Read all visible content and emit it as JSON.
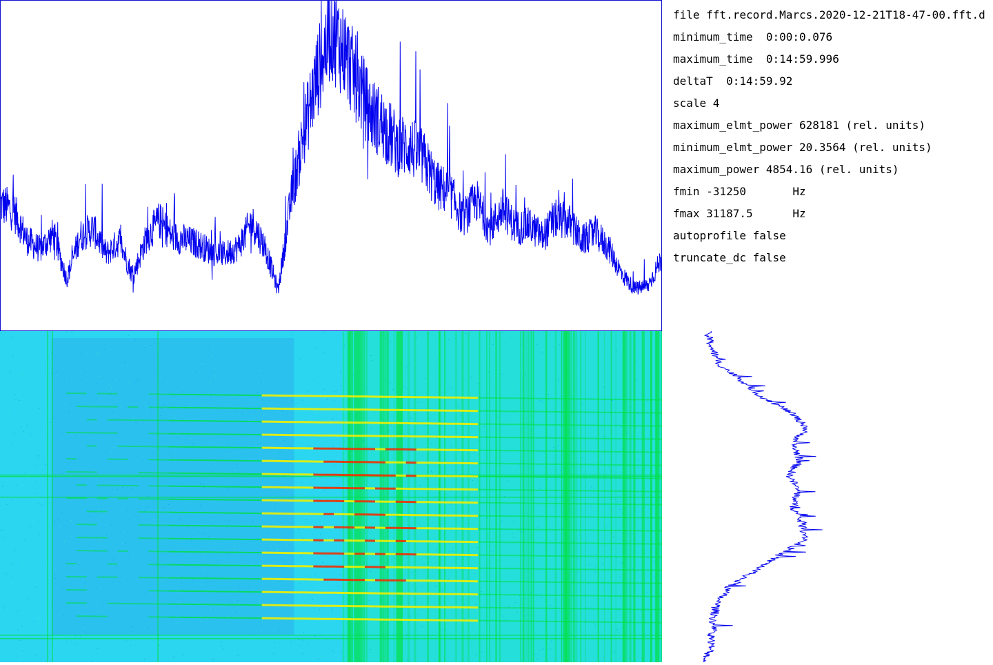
{
  "info": {
    "lines": [
      "file fft.record.Marcs.2020-12-21T18-47-00.fft.d",
      "minimum_time  0:00:0.076",
      "maximum_time  0:14:59.996",
      "deltaT  0:14:59.92",
      "scale 4",
      "maximum_elmt_power 628181 (rel. units)",
      "minimum_elmt_power 20.3564 (rel. units)",
      "maximum_power 4854.16 (rel. units)",
      "fmin -31250       Hz",
      "fmax 31187.5      Hz",
      "autoprofile false",
      "truncate_dc false"
    ]
  },
  "colors": {
    "trace": "#0000ee",
    "spectro_background": "#2bd6f0",
    "spectro_background_right": "#1fe8c8",
    "spectro_dark": "#2aa8ee",
    "spectro_green": "#00e040",
    "spectro_yellow": "#f0f000",
    "spectro_red": "#f03000"
  },
  "chart_data": [
    {
      "type": "line",
      "description_key": "total_power_vs_time",
      "title": "",
      "xlabel": "",
      "ylabel": "",
      "xlim": [
        0.076,
        899.996
      ],
      "ylim": [
        0,
        4854.16
      ],
      "x": [
        0,
        18,
        36,
        54,
        72,
        90,
        108,
        126,
        144,
        162,
        180,
        198,
        216,
        234,
        252,
        270,
        288,
        306,
        324,
        342,
        360,
        378,
        396,
        414,
        432,
        450,
        468,
        486,
        504,
        522,
        540,
        558,
        576,
        594,
        612,
        630,
        648,
        666,
        684,
        702,
        720,
        738,
        756,
        774,
        792,
        810,
        828,
        846,
        864,
        882,
        900
      ],
      "y": [
        1860,
        1760,
        1330,
        1190,
        1420,
        750,
        1390,
        1500,
        1120,
        1320,
        790,
        1350,
        1620,
        1380,
        1330,
        1270,
        1150,
        1120,
        1230,
        1600,
        1230,
        590,
        1960,
        2960,
        3790,
        4450,
        4110,
        3640,
        3210,
        3010,
        2730,
        2710,
        2520,
        2130,
        2020,
        1650,
        1920,
        1500,
        1790,
        1510,
        1550,
        1380,
        1640,
        1600,
        1320,
        1440,
        1220,
        830,
        610,
        660,
        1050
      ]
    },
    {
      "type": "heatmap",
      "description_key": "spectrogram",
      "title": "",
      "xlabel": "",
      "ylabel": "",
      "xlim": [
        0.076,
        899.996
      ],
      "ylim": [
        -31250,
        31187.5
      ],
      "levels": [
        "low",
        "mid",
        "high",
        "peak"
      ],
      "harmonic_lines": 18,
      "bright_region_time": [
        360,
        650
      ]
    },
    {
      "type": "line",
      "description_key": "frequency_profile",
      "title": "",
      "xlabel": "",
      "ylabel": "",
      "xlim": [
        0,
        1
      ],
      "ylim": [
        -31250,
        31187.5
      ],
      "freq": [
        31187.5,
        28000,
        25000,
        22000,
        19000,
        16000,
        13000,
        10000,
        7000,
        4000,
        1000,
        -2000,
        -5000,
        -8000,
        -11000,
        -14000,
        -17000,
        -20000,
        -23000,
        -26000,
        -29000,
        -31250
      ],
      "value": [
        0.02,
        0.05,
        0.09,
        0.22,
        0.33,
        0.5,
        0.6,
        0.52,
        0.56,
        0.5,
        0.55,
        0.52,
        0.57,
        0.6,
        0.44,
        0.3,
        0.15,
        0.08,
        0.06,
        0.05,
        0.04,
        0.0
      ]
    }
  ]
}
